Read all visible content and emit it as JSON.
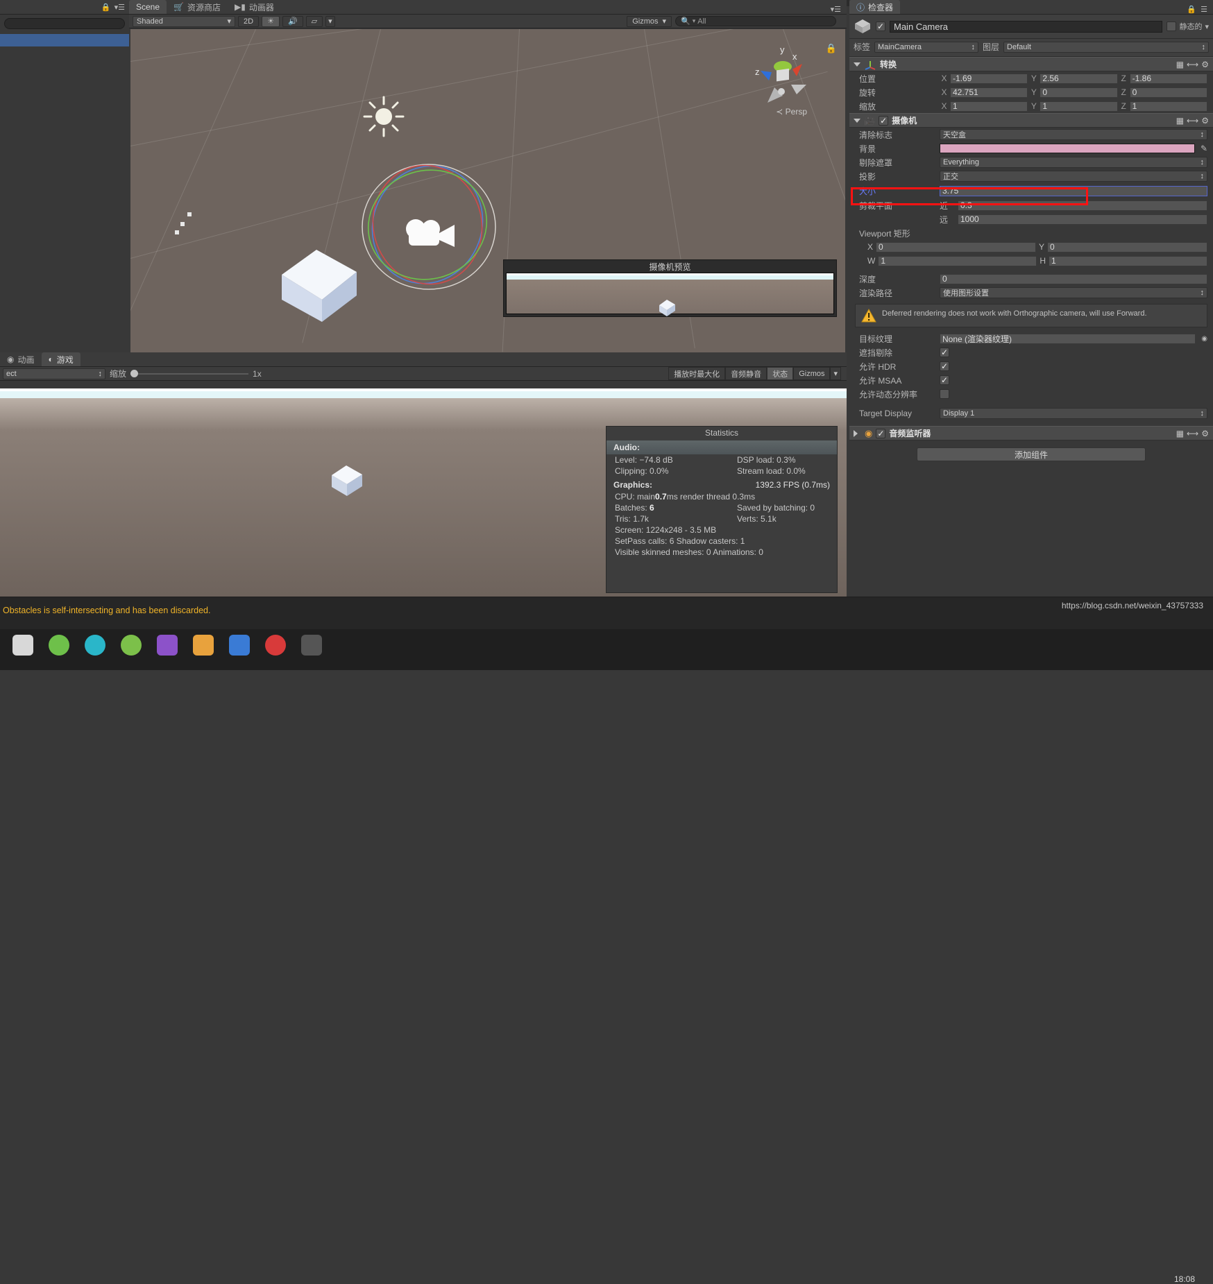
{
  "scene_panel": {
    "tabs": [
      {
        "label": "Scene",
        "icon": "scene-icon",
        "active": true
      },
      {
        "label": "资源商店",
        "icon": "asset-store-icon",
        "active": false
      },
      {
        "label": "动画器",
        "icon": "animator-icon",
        "active": false
      }
    ],
    "toolbar": {
      "draw_mode": "Shaded",
      "two_d": "2D",
      "lighting_icon": "sun-icon",
      "audio_icon": "speaker-icon",
      "fx_icon": "image-fx-icon",
      "gizmos": "Gizmos",
      "search_placeholder": "All",
      "search_icon": "search-icon"
    },
    "viewport": {
      "axis_labels": {
        "x": "x",
        "y": "y",
        "z": "z"
      },
      "projection_label": "Persp",
      "lock_icon": "lock-icon",
      "camera_preview_title": "摄像机预览"
    }
  },
  "game_panel": {
    "tabs": [
      {
        "label": "动画",
        "icon": "animation-icon",
        "active": false
      },
      {
        "label": "游戏",
        "icon": "game-icon",
        "active": true
      }
    ],
    "toolbar": {
      "aspect_value": "ect",
      "scale_label": "缩放",
      "scale_value": "1x",
      "maximize_on_play": "播放时最大化",
      "mute_audio": "音频静音",
      "stats": "状态",
      "gizmos": "Gizmos"
    }
  },
  "statistics": {
    "title": "Statistics",
    "audio_header": "Audio:",
    "audio_rows": [
      {
        "left": "Level: −74.8 dB",
        "right": "DSP load: 0.3%"
      },
      {
        "left": "Clipping: 0.0%",
        "right": "Stream load: 0.0%"
      }
    ],
    "graphics_header": "Graphics:",
    "fps": "1392.3 FPS (0.7ms)",
    "lines": [
      {
        "pre": "CPU: main ",
        "bold": "0.7",
        "post": "ms  render thread 0.3ms"
      }
    ],
    "rows": [
      {
        "left_label": "Batches: ",
        "left_bold": "6",
        "right": "Saved by batching: 0"
      },
      {
        "left_label": "Tris: 1.7k",
        "left_bold": "",
        "right": "Verts: 5.1k"
      }
    ],
    "screen": "Screen: 1224x248 - 3.5 MB",
    "setpass": "SetPass calls: 6    Shadow casters: 1",
    "skinned": "Visible skinned meshes: 0  Animations: 0"
  },
  "inspector": {
    "tab": {
      "label": "检查器",
      "icon": "info-icon"
    },
    "object": {
      "name": "Main Camera",
      "enabled": true,
      "icon": "gameobject-cube-icon",
      "static_label": "静态的",
      "static_checked": false,
      "tag_label": "标签",
      "tag_value": "MainCamera",
      "layer_label": "图层",
      "layer_value": "Default"
    },
    "transform": {
      "title": "转换",
      "icon": "transform-axis-icon",
      "rows": [
        {
          "label": "位置",
          "x": "-1.69",
          "y": "2.56",
          "z": "-1.86"
        },
        {
          "label": "旋转",
          "x": "42.751",
          "y": "0",
          "z": "0"
        },
        {
          "label": "缩放",
          "x": "1",
          "y": "1",
          "z": "1"
        }
      ],
      "axes": [
        "X",
        "Y",
        "Z"
      ]
    },
    "camera": {
      "title": "摄像机",
      "icon": "camera-icon",
      "enabled": true,
      "clear_flags_label": "清除标志",
      "clear_flags_value": "天空盒",
      "background_label": "背景",
      "background_color": "#dba5bf",
      "eyedropper_icon": "eyedropper-icon",
      "culling_label": "剔除遮罩",
      "culling_value": "Everything",
      "projection_label": "投影",
      "projection_value": "正交",
      "size_label": "大小",
      "size_value": "3.75",
      "clip_label": "剪裁平面",
      "clip_near_label": "近",
      "clip_near_value": "0.3",
      "clip_far_label": "远",
      "clip_far_value": "1000",
      "viewport_label": "Viewport 矩形",
      "viewport": {
        "x_label": "X",
        "x": "0",
        "y_label": "Y",
        "y": "0",
        "w_label": "W",
        "w": "1",
        "h_label": "H",
        "h": "1"
      },
      "depth_label": "深度",
      "depth_value": "0",
      "render_path_label": "渲染路径",
      "render_path_value": "使用图形设置",
      "warning_icon": "warning-triangle-icon",
      "warning_text": "Deferred rendering does not work with Orthographic camera, will use Forward.",
      "target_texture_label": "目标纹理",
      "target_texture_value": "None (渲染器纹理)",
      "target_texture_picker": "object-picker-icon",
      "occlusion_label": "遮挡剔除",
      "occlusion_checked": true,
      "hdr_label": "允许 HDR",
      "hdr_checked": true,
      "msaa_label": "允许 MSAA",
      "msaa_checked": true,
      "dynres_label": "允许动态分辨率",
      "dynres_checked": false,
      "target_display_label": "Target Display",
      "target_display_value": "Display 1"
    },
    "audio_listener": {
      "title": "音频监听器",
      "icon": "audio-listener-icon",
      "enabled": true
    },
    "add_component": "添加组件"
  },
  "status_bar": {
    "message": "Obstacles is self-intersecting and has been discarded.",
    "url": "https://blog.csdn.net/weixin_43757333",
    "clock": "18:08"
  },
  "colors": {
    "highlight_red": "#ff1212",
    "selection_blue": "#3d6094",
    "accent_tab": "#4b4b4b",
    "background_pink": "#dba5bf",
    "warning_yellow": "#f0b429"
  }
}
